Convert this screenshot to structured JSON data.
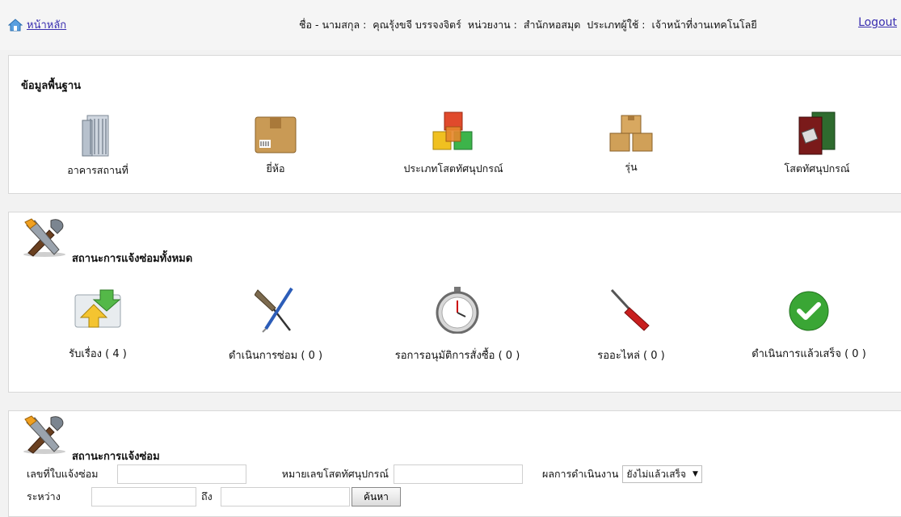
{
  "header": {
    "home_label": "หน้าหลัก",
    "name_label": "ชื่อ - นามสกุล :",
    "name_value": "คุณรุ้งขจี บรรจงจิตร์",
    "unit_label": "หน่วยงาน :",
    "unit_value": "สำนักหอสมุด",
    "user_type_label": "ประเภทผู้ใช้ :",
    "user_type_value": "เจ้าหน้าที่งานเทคโนโลยี",
    "logout_label": "Logout"
  },
  "basic": {
    "title": "ข้อมูลพื้นฐาน",
    "items": [
      {
        "label": "อาคารสถานที่",
        "icon": "building-icon"
      },
      {
        "label": "ยี่ห้อ",
        "icon": "box-icon"
      },
      {
        "label": "ประเภทโสตทัศนุปกรณ์",
        "icon": "cubes-icon"
      },
      {
        "label": "รุ่น",
        "icon": "boxes-icon"
      },
      {
        "label": "โสตทัศนุปกรณ์",
        "icon": "equipment-icon"
      }
    ]
  },
  "status_all": {
    "title": "สถานะการแจ้งซ่อมทั้งหมด",
    "items": [
      {
        "label": "รับเรื่อง ( 4 )",
        "icon": "receive-icon"
      },
      {
        "label": "ดำเนินการซ่อม ( 0 )",
        "icon": "repair-tools-icon"
      },
      {
        "label": "รอการอนุมัติการสั่งซื้อ ( 0 )",
        "icon": "stopwatch-icon"
      },
      {
        "label": "รออะไหล่ ( 0 )",
        "icon": "screwdriver-icon"
      },
      {
        "label": "ดำเนินการแล้วเสร็จ ( 0 )",
        "icon": "check-icon"
      }
    ]
  },
  "status_search": {
    "title": "สถานะการแจ้งซ่อม",
    "ticket_label": "เลขที่ใบแจ้งซ่อม",
    "equipment_no_label": "หมายเลขโสตทัศนุปกรณ์",
    "result_label": "ผลการดำเนินงาน",
    "result_selected": "ยังไม่แล้วเสร็จ",
    "between_label": "ระหว่าง",
    "to_label": "ถึง",
    "search_button": "ค้นหา"
  }
}
